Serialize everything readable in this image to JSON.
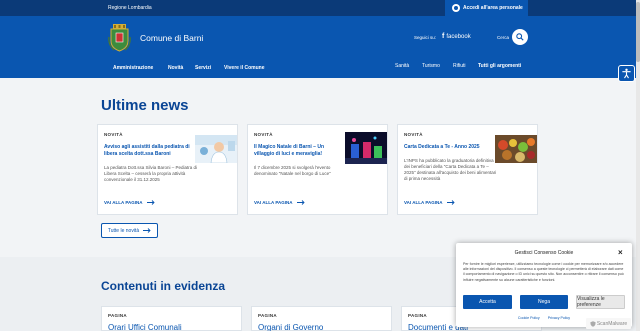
{
  "topbar": {
    "region": "Regione Lombardia",
    "login": "Accedi all'area personale"
  },
  "header": {
    "site_title": "Comune di Barni",
    "follow_label": "Seguici su:",
    "facebook": "facebook",
    "search_label": "Cerca"
  },
  "nav": {
    "main": [
      "Amministrazione",
      "Novità",
      "Servizi",
      "Vivere il Comune"
    ],
    "secondary": [
      "Sanità",
      "Turismo",
      "Rifiuti",
      "Tutti gli argomenti"
    ]
  },
  "news": {
    "title": "Ultime news",
    "more_label": "VAI ALLA PAGINA",
    "cards": [
      {
        "category": "NOVITÀ",
        "title": "Avviso agli assistiti dalla pediatra di libera scelta dott.ssa Baroni",
        "text": "La pediatra Dott.ssa Silvia Baroni – Pediatra di Libera Scelta – cesserà la propria attività convenzionale il 31.12.2025"
      },
      {
        "category": "NOVITÀ",
        "title": "Il Magico Natale di Barni – Un villaggio di luci e meraviglia!",
        "text": "Il 7 dicembre 2025 si svolgerà l'evento denominato \"Natale nel borgo di Luce\""
      },
      {
        "category": "NOVITÀ",
        "title": "Carta Dedicata a Te - Anno 2025",
        "text": "L'INPS ha pubblicato la graduatoria definitiva dei beneficiari della \"Carta Dedicata a Te – 2025\" destinata all'acquisto dei beni alimentari di prima necessità"
      }
    ],
    "all_label": "Tutte le novità"
  },
  "featured": {
    "title": "Contenuti in evidenza",
    "cards": [
      {
        "category": "PAGINA",
        "title": "Orari Uffici Comunali"
      },
      {
        "category": "PAGINA",
        "title": "Organi di Governo"
      },
      {
        "category": "PAGINA",
        "title": "Documenti e dati"
      }
    ]
  },
  "cookie": {
    "title": "Gestisci Consenso Cookie",
    "body": "Per fornire le migliori esperienze, utilizziamo tecnologie come i cookie per memorizzare e/o accedere alle informazioni del dispositivo. Il consenso a queste tecnologie ci permetterà di elaborare dati come il comportamento di navigazione o ID unici su questo sito. Non acconsentire o ritirare il consenso può influire negativamente su alcune caratteristiche e funzioni.",
    "accept": "Accetta",
    "deny": "Nega",
    "preferences": "Visualizza le preferenze",
    "cookie_policy": "Cookie Policy",
    "privacy_policy": "Privacy Policy"
  },
  "badge": {
    "label": "ScanMalware"
  },
  "colors": {
    "primary": "#0a56b0",
    "dark": "#0b3a78",
    "heading": "#0a4595"
  }
}
